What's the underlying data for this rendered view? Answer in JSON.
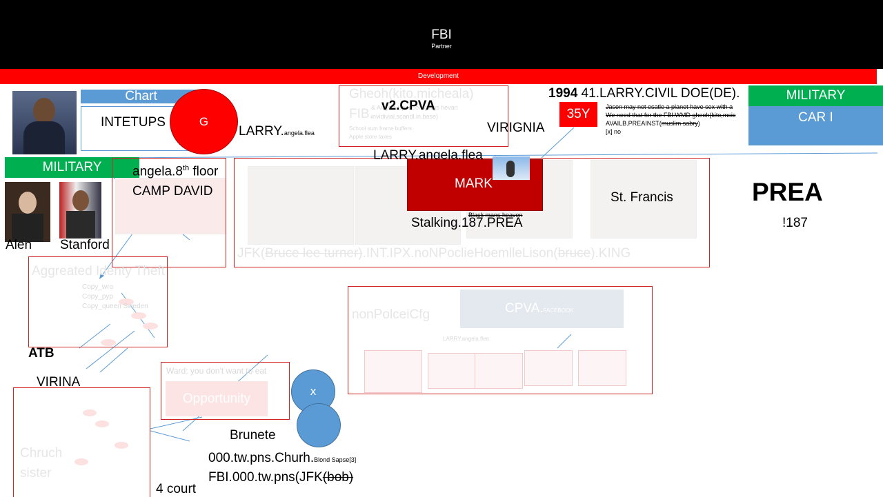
{
  "header": {
    "title": "FBI",
    "subtitle": "Partner",
    "bar": "Development"
  },
  "chart_label": "Chart",
  "intetups": "INTETUPS",
  "g_circle": "G",
  "larry_small": {
    "main": "LARRY.",
    "sub": "angela.flea"
  },
  "faded_top": {
    "line1": "Gheoh(kito.micheala)",
    "line2": "FIB.",
    "small1": "& Angela.Sponsorhgings hevan",
    "small2": "invidivial.scandl.in.base)",
    "small3": "School sum frame buffers",
    "small4": "Apple store taxes"
  },
  "v2cpva": "v2.CPVA",
  "virignia": "VIRIGNIA",
  "doe_title": {
    "year": "1994",
    "rest": " 41.LARRY.CIVIL DOE(DE)."
  },
  "badge_35y": "35Y",
  "notes": {
    "n1": "Jason may not esatle a planet have sex with a",
    "n2": "We need that for the FBI:WMD gheoh(kito,mcic",
    "n3": "AVAILB.PREAINST(",
    "n3s": "muslim sabry",
    "n3e": ")",
    "n4": "[x] no"
  },
  "military_right": "MILITARY",
  "car": "CAR I",
  "larry_big": "LARRY.angela.flea",
  "military_left": "MILITARY",
  "angela": {
    "main": "angela.8",
    "sup": "th",
    "rest": " floor"
  },
  "camp_david": "CAMP DAVID",
  "mark": "MARK",
  "black_mans": "Black mans heaven",
  "stalking": "Stalking.187.PREA",
  "st_francis": "St. Francis",
  "prea": "PREA",
  "prea_187": "!187",
  "alen": "Alen",
  "stanford": "Stanford",
  "jfk_line": {
    "a": "JFK(",
    "b": "Bruce lee turner)",
    "c": ".INT.IPX.noNPoclieHoemlleLison(",
    "d": "bruce",
    "e": ").KING"
  },
  "aggregated": "Aggreated Identy Theft",
  "copy_items": [
    "Copy_wro",
    "Copy_pyp",
    "Copy_queen Sweden"
  ],
  "nonpolceicfg": "nonPolceiCfg",
  "cpva": {
    "main": "CPVA.",
    "sub": "FACEBOOK"
  },
  "larry_tiny": "LARRY.angela.flea",
  "atb": "ATB",
  "virina": "VIRINA",
  "ward": "Ward: you don't  want to eat",
  "opportunity": "Opportunity",
  "x_circle": "x",
  "brunete": "Brunete",
  "chruch": [
    "Chruch",
    "sister"
  ],
  "tw_line": {
    "main": "000.tw.pns.Churh.",
    "sub": "Blond Sapse[3]"
  },
  "fbi_line": {
    "main": "FBI.000.tw.pns(JFK",
    "strike": "(bob)"
  },
  "four_court": "4 court",
  "colors": {
    "red": "#ff0000",
    "green": "#00b050",
    "blue": "#5b9bd5",
    "darkred": "#c00000"
  }
}
